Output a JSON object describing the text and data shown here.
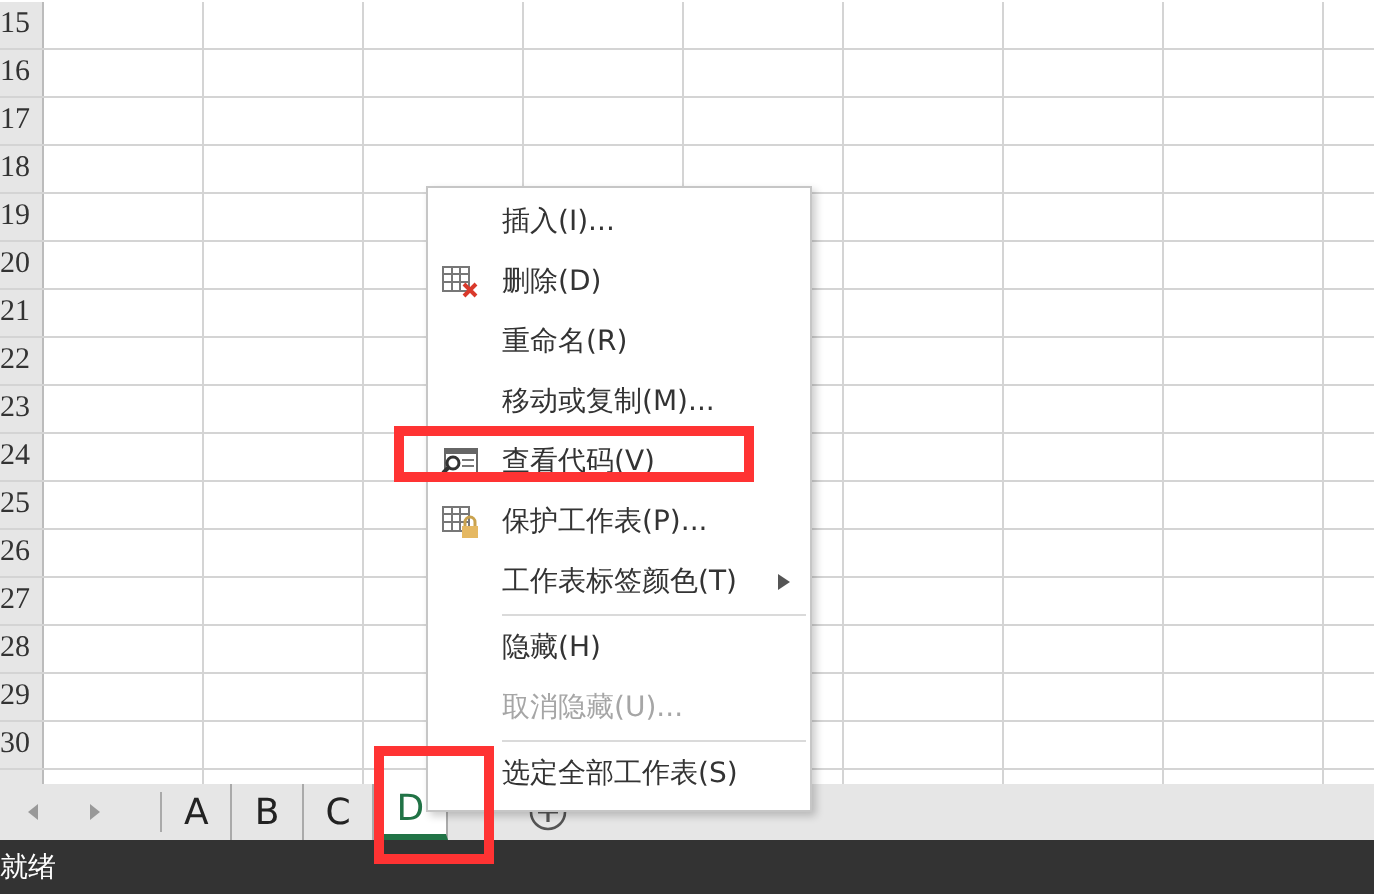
{
  "rows": [
    "15",
    "16",
    "17",
    "18",
    "19",
    "20",
    "21",
    "22",
    "23",
    "24",
    "25",
    "26",
    "27",
    "28",
    "29",
    "30"
  ],
  "context_menu": {
    "items": [
      {
        "kind": "plain",
        "label": "插入(I)...",
        "disabled": false,
        "submenu": false,
        "highlighted": false
      },
      {
        "kind": "delete",
        "label": "删除(D)",
        "disabled": false,
        "submenu": false,
        "highlighted": false
      },
      {
        "kind": "plain",
        "label": "重命名(R)",
        "disabled": false,
        "submenu": false,
        "highlighted": false
      },
      {
        "kind": "plain",
        "label": "移动或复制(M)...",
        "disabled": false,
        "submenu": false,
        "highlighted": false
      },
      {
        "kind": "code",
        "label": "查看代码(V)",
        "disabled": false,
        "submenu": false,
        "highlighted": true
      },
      {
        "kind": "protect",
        "label": "保护工作表(P)...",
        "disabled": false,
        "submenu": false,
        "highlighted": false
      },
      {
        "kind": "plain",
        "label": "工作表标签颜色(T)",
        "disabled": false,
        "submenu": true,
        "highlighted": false
      },
      {
        "kind": "separator"
      },
      {
        "kind": "plain",
        "label": "隐藏(H)",
        "disabled": false,
        "submenu": false,
        "highlighted": false
      },
      {
        "kind": "plain",
        "label": "取消隐藏(U)...",
        "disabled": true,
        "submenu": false,
        "highlighted": false
      },
      {
        "kind": "separator"
      },
      {
        "kind": "plain",
        "label": "选定全部工作表(S)",
        "disabled": false,
        "submenu": false,
        "highlighted": false
      }
    ]
  },
  "sheet_tabs": [
    {
      "label": "A",
      "selected": false
    },
    {
      "label": "B",
      "selected": false
    },
    {
      "label": "C",
      "selected": false
    },
    {
      "label": "D",
      "selected": true
    }
  ],
  "status_bar": {
    "text": "就绪"
  }
}
